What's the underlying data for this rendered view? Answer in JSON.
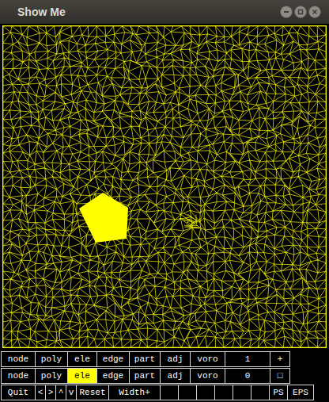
{
  "window": {
    "title": "Show Me"
  },
  "button_rows": [
    {
      "buttons": [
        {
          "label": "node",
          "selected": false
        },
        {
          "label": "poly",
          "selected": false
        },
        {
          "label": "ele",
          "selected": false
        },
        {
          "label": "edge",
          "selected": false
        },
        {
          "label": "part",
          "selected": false
        },
        {
          "label": "adj",
          "selected": false
        },
        {
          "label": "voro",
          "selected": false
        },
        {
          "label": "1",
          "selected": false
        },
        {
          "label": "+",
          "selected": false
        }
      ]
    },
    {
      "buttons": [
        {
          "label": "node",
          "selected": false
        },
        {
          "label": "poly",
          "selected": false
        },
        {
          "label": "ele",
          "selected": true
        },
        {
          "label": "edge",
          "selected": false
        },
        {
          "label": "part",
          "selected": false
        },
        {
          "label": "adj",
          "selected": false
        },
        {
          "label": "voro",
          "selected": false
        },
        {
          "label": "0",
          "selected": false
        },
        {
          "label": "□",
          "selected": false
        }
      ]
    },
    {
      "buttons": [
        {
          "label": "Quit",
          "selected": false
        },
        {
          "label": "<",
          "selected": false
        },
        {
          "label": ">",
          "selected": false
        },
        {
          "label": "^",
          "selected": false
        },
        {
          "label": "v",
          "selected": false
        },
        {
          "label": "Reset",
          "selected": false
        },
        {
          "label": "Width+",
          "selected": false
        },
        {
          "label": "",
          "selected": false
        },
        {
          "label": "",
          "selected": false
        },
        {
          "label": "",
          "selected": false
        },
        {
          "label": "",
          "selected": false
        },
        {
          "label": "",
          "selected": false
        },
        {
          "label": "",
          "selected": false
        },
        {
          "label": "PS",
          "selected": false
        },
        {
          "label": "EPS",
          "selected": false
        }
      ]
    }
  ]
}
